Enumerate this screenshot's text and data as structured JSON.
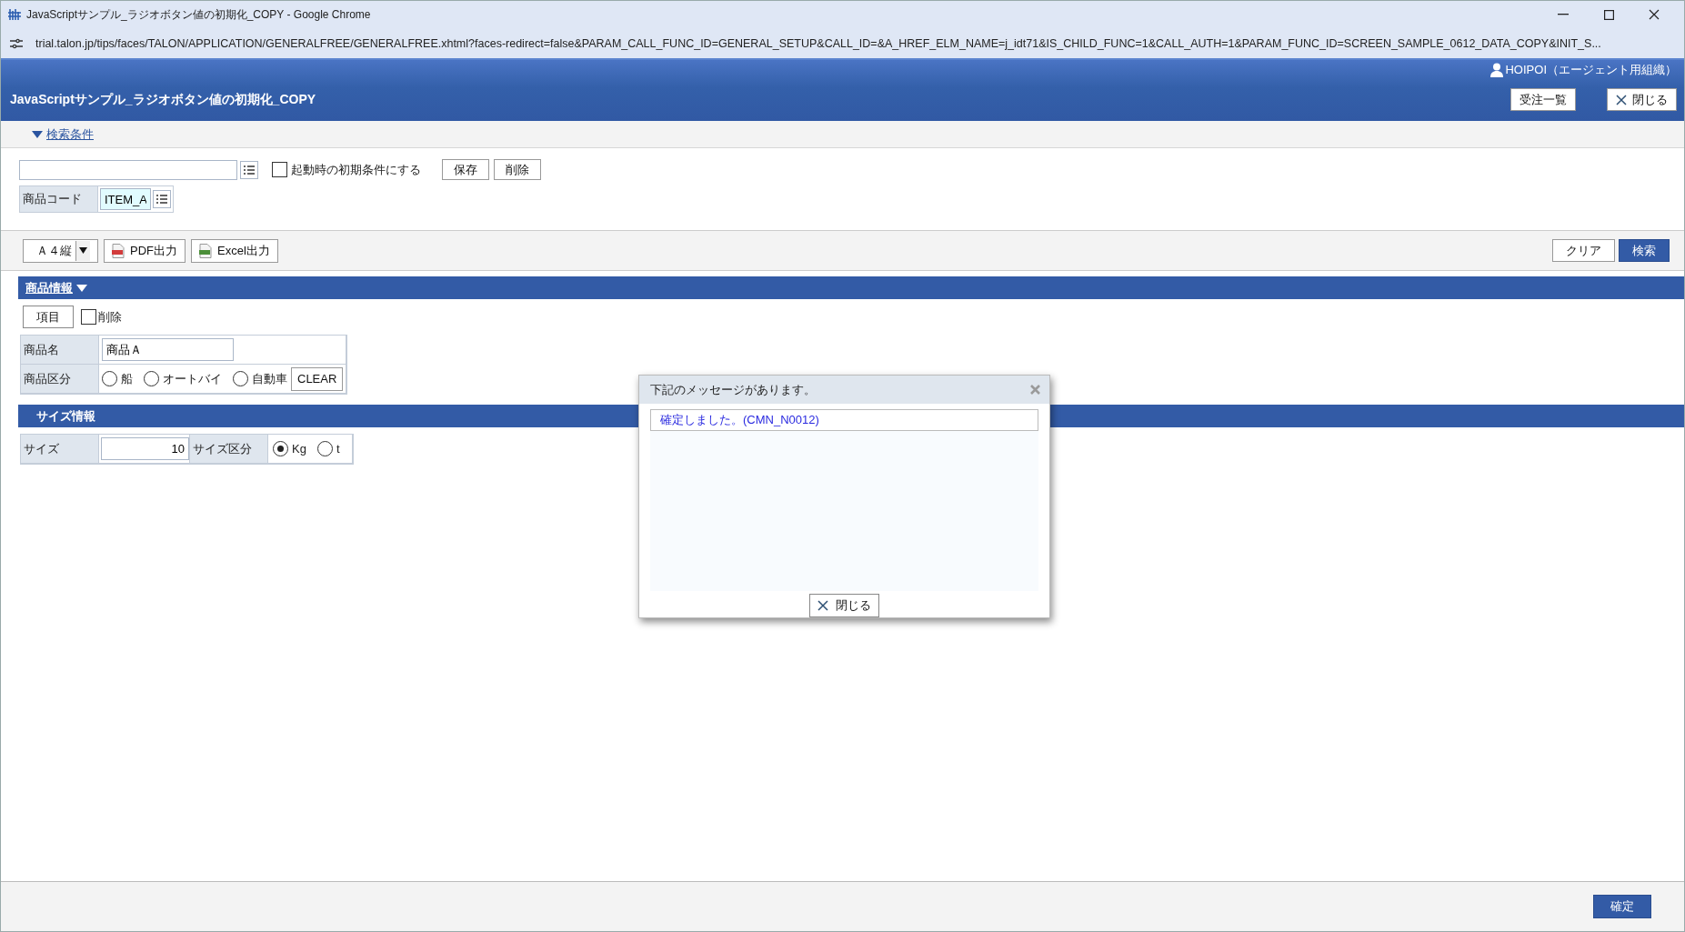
{
  "browser": {
    "title": "JavaScriptサンプル_ラジオボタン値の初期化_COPY - Google Chrome",
    "url": "trial.talon.jp/tips/faces/TALON/APPLICATION/GENERALFREE/GENERALFREE.xhtml?faces-redirect=false&PARAM_CALL_FUNC_ID=GENERAL_SETUP&CALL_ID=&A_HREF_ELM_NAME=j_idt71&IS_CHILD_FUNC=1&CALL_AUTH=1&PARAM_FUNC_ID=SCREEN_SAMPLE_0612_DATA_COPY&INIT_S..."
  },
  "header": {
    "user": "HOIPOI（エージェント用組織）",
    "title": "JavaScriptサンプル_ラジオボタン値の初期化_COPY",
    "buttons": [
      {
        "label": "受注一覧",
        "kind": "plain"
      },
      {
        "label": "閉じる",
        "kind": "close"
      }
    ]
  },
  "search": {
    "toggle": "検索条件",
    "expanded": true,
    "default_checkbox": {
      "label": "起動時の初期条件にする",
      "checked": false
    },
    "buttons": [
      "保存",
      "削除"
    ],
    "fields": [
      {
        "label": "商品コード",
        "value": "ITEM_A"
      }
    ]
  },
  "toolbar": {
    "paper": "Ａ４縦",
    "exports": [
      {
        "label": "PDF出力",
        "kind": "pdf"
      },
      {
        "label": "Excel出力",
        "kind": "excel"
      }
    ],
    "buttons": [
      {
        "label": "クリア",
        "primary": false
      },
      {
        "label": "検索",
        "primary": true
      }
    ]
  },
  "product_section": {
    "title": "商品情報",
    "expanded": true,
    "item_button": "項目",
    "delete_checkbox": {
      "label": "削除",
      "checked": false
    },
    "name": {
      "label": "商品名",
      "value": "商品Ａ"
    },
    "category": {
      "label": "商品区分",
      "options": [
        {
          "label": "船",
          "selected": false
        },
        {
          "label": "オートバイ",
          "selected": false
        },
        {
          "label": "自動車",
          "selected": false
        }
      ],
      "clear": "CLEAR"
    }
  },
  "size_section": {
    "title": "サイズ情報",
    "size": {
      "label": "サイズ",
      "value": "10"
    },
    "unit": {
      "label": "サイズ区分",
      "options": [
        {
          "label": "Kg",
          "selected": true
        },
        {
          "label": "t",
          "selected": false
        }
      ]
    }
  },
  "dialog": {
    "title": "下記のメッセージがあります。",
    "messages": [
      "確定しました。(CMN_N0012)"
    ],
    "close": "閉じる"
  },
  "footer": {
    "confirm": "確定"
  }
}
